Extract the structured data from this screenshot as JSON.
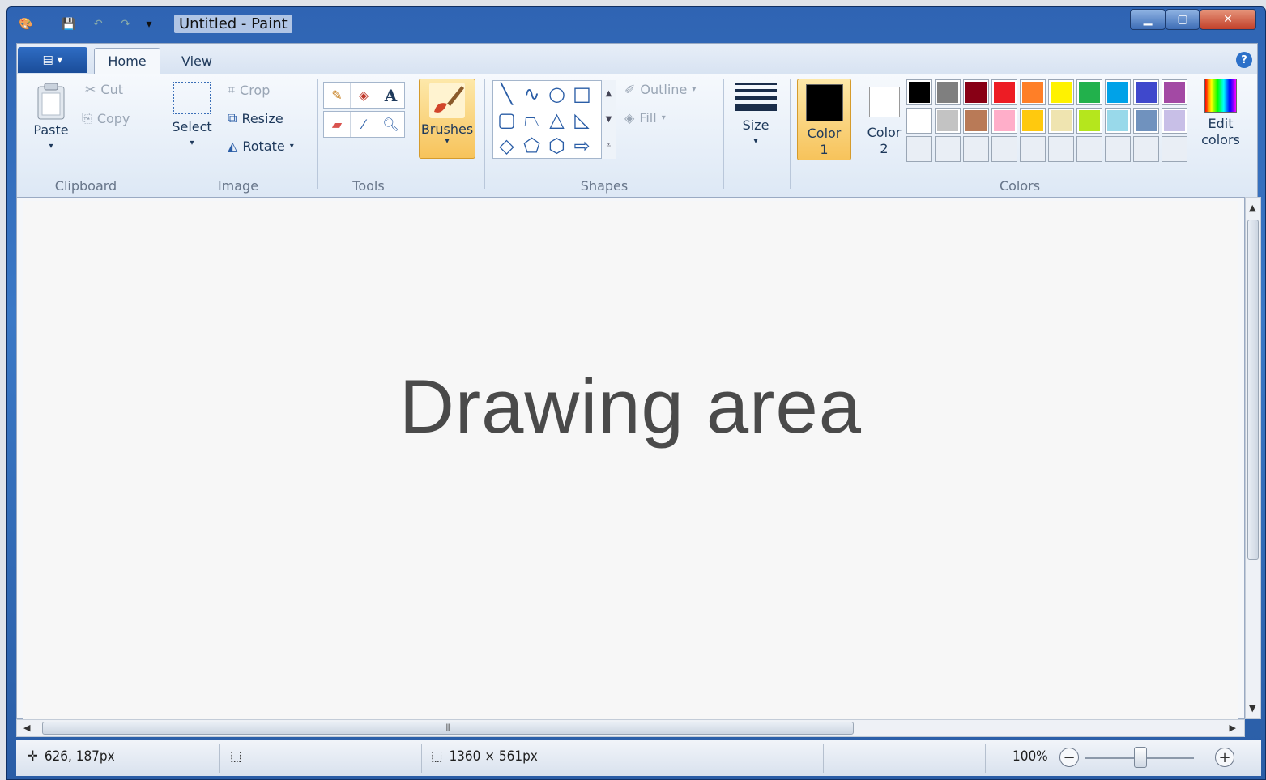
{
  "window": {
    "title": "Untitled - Paint"
  },
  "tabs": {
    "file_icon": "paint-menu-icon",
    "home": "Home",
    "view": "View",
    "help": "?"
  },
  "clipboard": {
    "paste": "Paste",
    "cut": "Cut",
    "copy": "Copy",
    "label": "Clipboard"
  },
  "image": {
    "select": "Select",
    "crop": "Crop",
    "resize": "Resize",
    "rotate": "Rotate",
    "label": "Image"
  },
  "tools": {
    "label": "Tools",
    "text_tool": "A"
  },
  "brushes": {
    "label": "Brushes"
  },
  "shapes": {
    "outline": "Outline",
    "fill": "Fill",
    "label": "Shapes"
  },
  "size": {
    "label": "Size"
  },
  "colors": {
    "color1": "Color\n1",
    "color1_line1": "Color",
    "color1_line2": "1",
    "color2_line1": "Color",
    "color2_line2": "2",
    "edit_line1": "Edit",
    "edit_line2": "colors",
    "label": "Colors",
    "color1_value": "#000000",
    "color2_value": "#ffffff",
    "palette": [
      "#000000",
      "#7f7f7f",
      "#880015",
      "#ed1c24",
      "#ff7f27",
      "#fff200",
      "#22b14c",
      "#00a2e8",
      "#3f48cc",
      "#a349a4",
      "#ffffff",
      "#c3c3c3",
      "#b97a57",
      "#ffaec9",
      "#ffc90e",
      "#efe4b0",
      "#b5e61d",
      "#99d9ea",
      "#7092be",
      "#c8bfe7"
    ]
  },
  "canvas": {
    "text": "Drawing area"
  },
  "status": {
    "cursor": "626, 187px",
    "canvas_size": "1360 × 561px",
    "zoom": "100%"
  }
}
